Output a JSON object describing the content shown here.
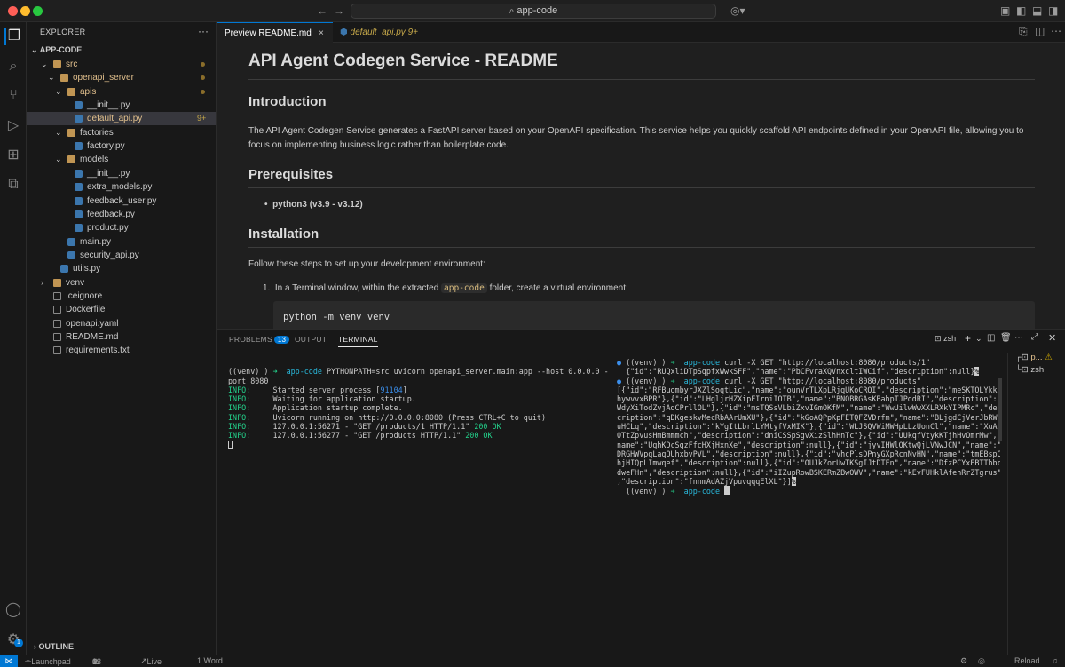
{
  "titlebar": {
    "search": "app-code",
    "back": "←",
    "forward": "→"
  },
  "activity": {
    "items": [
      "explorer",
      "search",
      "source-control",
      "run-debug",
      "extensions",
      "remote"
    ],
    "accounts_badge": "1"
  },
  "explorer": {
    "title": "EXPLORER",
    "more": "···",
    "root": "APP-CODE",
    "outline": "OUTLINE",
    "tree": [
      {
        "label": "src",
        "depth": 1,
        "type": "folder",
        "open": true,
        "dot": true
      },
      {
        "label": "openapi_server",
        "depth": 2,
        "type": "folder",
        "open": true,
        "dot": true
      },
      {
        "label": "apis",
        "depth": 3,
        "type": "folder",
        "open": true,
        "dot": true
      },
      {
        "label": "__init__.py",
        "depth": 4,
        "type": "py"
      },
      {
        "label": "default_api.py",
        "depth": 4,
        "type": "py",
        "selected": true,
        "badge": "9+"
      },
      {
        "label": "factories",
        "depth": 3,
        "type": "folder",
        "open": true
      },
      {
        "label": "factory.py",
        "depth": 4,
        "type": "py"
      },
      {
        "label": "models",
        "depth": 3,
        "type": "folder",
        "open": true
      },
      {
        "label": "__init__.py",
        "depth": 4,
        "type": "py"
      },
      {
        "label": "extra_models.py",
        "depth": 4,
        "type": "py"
      },
      {
        "label": "feedback_user.py",
        "depth": 4,
        "type": "py"
      },
      {
        "label": "feedback.py",
        "depth": 4,
        "type": "py"
      },
      {
        "label": "product.py",
        "depth": 4,
        "type": "py"
      },
      {
        "label": "main.py",
        "depth": 3,
        "type": "py"
      },
      {
        "label": "security_api.py",
        "depth": 3,
        "type": "py"
      },
      {
        "label": "utils.py",
        "depth": 2,
        "type": "py"
      },
      {
        "label": "venv",
        "depth": 1,
        "type": "folder",
        "open": false
      },
      {
        "label": ".ceignore",
        "depth": 1,
        "type": "file"
      },
      {
        "label": "Dockerfile",
        "depth": 1,
        "type": "file"
      },
      {
        "label": "openapi.yaml",
        "depth": 1,
        "type": "file"
      },
      {
        "label": "README.md",
        "depth": 1,
        "type": "file"
      },
      {
        "label": "requirements.txt",
        "depth": 1,
        "type": "file"
      }
    ]
  },
  "tabs": [
    {
      "label": "Preview README.md",
      "close": "×"
    },
    {
      "label": "default_api.py",
      "badge": "9+"
    }
  ],
  "readme": {
    "title": "API Agent Codegen Service - README",
    "intro_heading": "Introduction",
    "intro_text": "The API Agent Codegen Service generates a FastAPI server based on your OpenAPI specification. This service helps you quickly scaffold API endpoints defined in your OpenAPI file, allowing you to focus on implementing business logic rather than boilerplate code.",
    "prereq_heading": "Prerequisites",
    "prereq_item": "python3 (v3.9 - v3.12)",
    "install_heading": "Installation",
    "install_text": "Follow these steps to set up your development environment:",
    "step1_before": "In a Terminal window, within the extracted ",
    "step1_code": "app-code",
    "step1_after": " folder, create a virtual environment:",
    "code": "python -m venv venv"
  },
  "panel": {
    "tabs": {
      "problems": "PROBLEMS",
      "problems_count": "13",
      "output": "OUTPUT",
      "terminal": "TERMINAL"
    },
    "shell": "zsh",
    "terminal_list": [
      "p...",
      "zsh"
    ]
  },
  "terminal_left": {
    "prompt_env": "((venv) )",
    "prompt_dir": "app-code",
    "cmd1": "PYTHONPATH=src uvicorn openapi_server.main:app --host 0.0.0.0 --",
    "cmd1_wrap": "port 8080",
    "lines": [
      {
        "level": "INFO:",
        "text": "Started server process [",
        "pid": "91104",
        "after": "]"
      },
      {
        "level": "INFO:",
        "text": "Waiting for application startup."
      },
      {
        "level": "INFO:",
        "text": "Application startup complete."
      },
      {
        "level": "INFO:",
        "text": "Uvicorn running on http://0.0.0.0:8080 (Press CTRL+C to quit)"
      },
      {
        "level": "INFO:",
        "text": "127.0.0.1:56271 - \"GET /products/1 HTTP/1.1\" ",
        "status": "200 OK"
      },
      {
        "level": "INFO:",
        "text": "127.0.0.1:56277 - \"GET /products HTTP/1.1\" ",
        "status": "200 OK"
      }
    ]
  },
  "terminal_right": {
    "prompt_env": "((venv) )",
    "prompt_dir": "app-code",
    "cmd1": "curl -X GET \"http://localhost:8080/products/1\"",
    "out1": "{\"id\":\"RUQxliDTpSqpfxWwkSFF\",\"name\":\"PbCFvraXQVnxcltIWCif\",\"description\":null}",
    "cmd2": "curl -X GET \"http://localhost:8080/products\"",
    "out2": [
      "[{\"id\":\"RFBuombyrJXZlSoqtLic\",\"name\":\"ounVrTLXpLRjqUKoCRQI\",\"description\":\"meSKTOLYkke",
      "hywvvxBPR\"},{\"id\":\"LHgljrHZXipFIrniIOTB\",\"name\":\"BNOBRGAsKBahpTJPddRI\",\"description\":\"",
      "WdyXiTodZvjAdCPrllOL\"},{\"id\":\"msTQSsVLbiZxvIGmOKfM\",\"name\":\"WwUilwWwXXLRXkYIPMRc\",\"des",
      "cription\":\"qDKgeskvMecRbAArUmXU\"},{\"id\":\"kGoAQPpKpFETQFZVDrfm\",\"name\":\"BLjgdCjVerJbRWk",
      "uHCLq\",\"description\":\"kYgItLbrlLYMtyfVxMIK\"},{\"id\":\"WLJSQVWiMWHpLLzUonCl\",\"name\":\"XuAH",
      "OTtZpvusHmBmmmch\",\"description\":\"dniCSSpSgvXizSlhHnTc\"},{\"id\":\"UUkqfVtykKTjhHvOmrMw\",\"",
      "name\":\"UghKDcSgzFfcHXjHxnXe\",\"description\":null},{\"id\":\"jyvIHWlOKtwQjLVNwJCN\",\"name\":\"",
      "DRGHWVpqLaqOUhxbvPVL\",\"description\":null},{\"id\":\"vhcPlsDPnyGXpRcnNvHN\",\"name\":\"tmEBspO",
      "hjHIQpLImwqef\",\"description\":null},{\"id\":\"OUJkZorUwTKSgIJtDTFn\",\"name\":\"DfzPCYxEBTThbc",
      "dweFHn\",\"description\":null},{\"id\":\"iIZupRowBSKERmZBwOWV\",\"name\":\"kEvFUHklAfehRrZTgrus\"",
      ",\"description\":\"fnnmAdAZjVpuvqqqElXL\"}]"
    ],
    "percent_mark": "%"
  },
  "status": {
    "remote": "⋈",
    "launchpad": "Launchpad",
    "errors": "0",
    "warnings": "13",
    "live_share": "Live Share",
    "words": "1 Word",
    "reload": "Reload"
  },
  "colors": {
    "accent": "#0078d4",
    "folder": "#c09553",
    "python": "#3b76ad",
    "modified": "#c7a94a",
    "prompt_green": "#23d18b",
    "prompt_cyan": "#29b8db"
  }
}
